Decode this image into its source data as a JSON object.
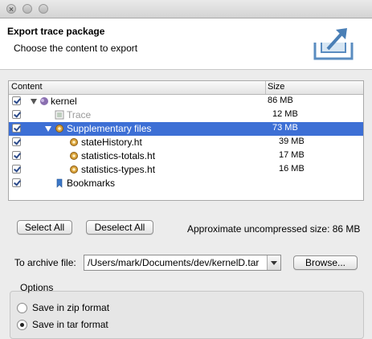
{
  "window": {
    "title": ""
  },
  "header": {
    "title": "Export trace package",
    "subtitle": "Choose the content to export",
    "icon": "export-box-icon"
  },
  "table": {
    "columns": [
      "Content",
      "Size"
    ],
    "rows": [
      {
        "label": "kernel",
        "size": "86 MB",
        "checked": true,
        "expanded": true,
        "icon": "trace-node-icon"
      },
      {
        "label": "Trace",
        "size": "12 MB",
        "checked": true,
        "disabled": true,
        "icon": "trace-file-icon"
      },
      {
        "label": "Supplementary files",
        "size": "73 MB",
        "checked": true,
        "expanded": true,
        "selected": true,
        "icon": "gear-icon"
      },
      {
        "label": "stateHistory.ht",
        "size": "39 MB",
        "checked": true,
        "icon": "gear-icon"
      },
      {
        "label": "statistics-totals.ht",
        "size": "17 MB",
        "checked": true,
        "icon": "gear-icon"
      },
      {
        "label": "statistics-types.ht",
        "size": "16 MB",
        "checked": true,
        "icon": "gear-icon"
      },
      {
        "label": "Bookmarks",
        "size": "",
        "checked": true,
        "icon": "bookmark-icon"
      }
    ]
  },
  "buttons": {
    "select_all": "Select All",
    "deselect_all": "Deselect All",
    "browse": "Browse..."
  },
  "approx_size": "Approximate uncompressed size: 86 MB",
  "archive": {
    "label": "To archive file:",
    "value": "/Users/mark/Documents/dev/kernelD.tar"
  },
  "options": {
    "label": "Options",
    "zip": "Save in zip format",
    "tar": "Save in tar format",
    "selected": "tar"
  }
}
